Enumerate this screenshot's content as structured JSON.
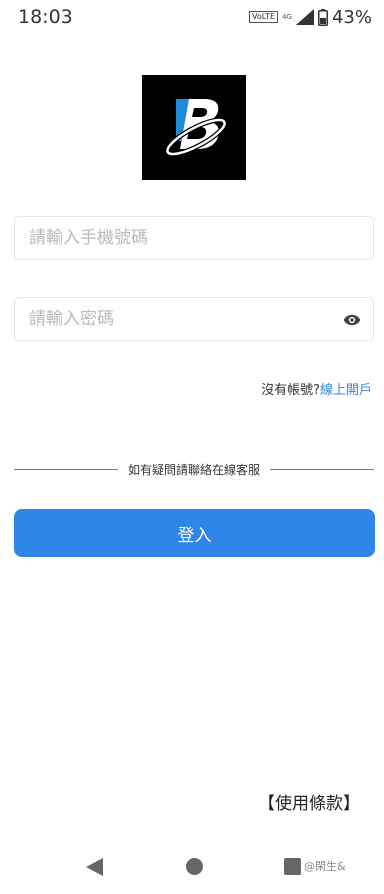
{
  "status_bar": {
    "time": "18:03",
    "volte": "VoLTE",
    "network": "4G",
    "battery": "43%"
  },
  "form": {
    "phone_placeholder": "請輸入手機號碼",
    "password_placeholder": "請輸入密碼"
  },
  "register": {
    "prompt": "沒有帳號?",
    "link": "線上開戶"
  },
  "support_text": "如有疑問請聯絡在線客服",
  "login_label": "登入",
  "terms_label": "【使用條款】",
  "watermark": "@閑生&",
  "colors": {
    "accent": "#2e86e8",
    "logo_background": "#000000"
  },
  "icons": {
    "password_toggle": "eye-icon",
    "nav_back": "back-triangle-icon",
    "nav_home": "home-circle-icon",
    "nav_recent": "recent-square-icon"
  }
}
